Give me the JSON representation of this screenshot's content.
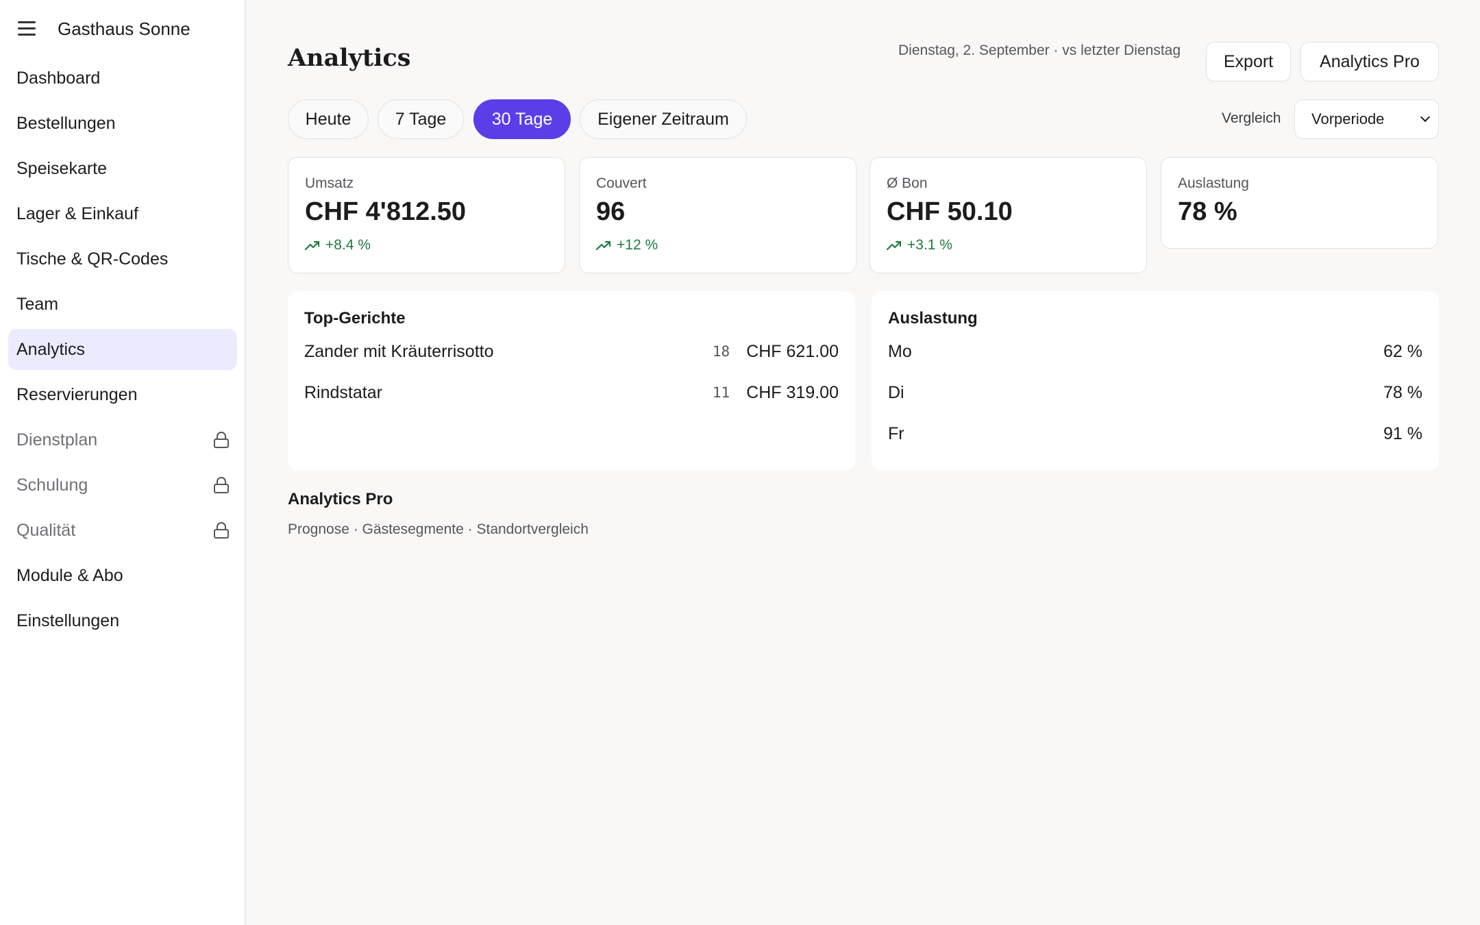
{
  "app": {
    "name": "Gasthaus Sonne"
  },
  "sidebar": {
    "items": [
      {
        "label": "Dashboard"
      },
      {
        "label": "Bestellungen"
      },
      {
        "label": "Speisekarte"
      },
      {
        "label": "Lager & Einkauf"
      },
      {
        "label": "Tische & QR-Codes"
      },
      {
        "label": "Team"
      },
      {
        "label": "Analytics",
        "active": true
      },
      {
        "label": "Reservierungen"
      },
      {
        "label": "Dienstplan",
        "locked": true
      },
      {
        "label": "Schulung",
        "locked": true
      },
      {
        "label": "Qualität",
        "locked": true
      },
      {
        "label": "Module & Abo"
      },
      {
        "label": "Einstellungen"
      }
    ]
  },
  "header": {
    "title": "Analytics",
    "date_info": "Dienstag, 2. September · vs letzter Dienstag",
    "export_label": "Export",
    "pro_label": "Analytics Pro"
  },
  "filters": {
    "ranges": [
      "Heute",
      "7 Tage",
      "30 Tage",
      "Eigener Zeitraum"
    ],
    "active_range": "30 Tage",
    "compare_label": "Vergleich",
    "compare_value": "Vorperiode"
  },
  "kpis": [
    {
      "label": "Umsatz",
      "value": "CHF 4'812.50",
      "delta": "+8.4 %"
    },
    {
      "label": "Couvert",
      "value": "96",
      "delta": "+12 %"
    },
    {
      "label": "Ø Bon",
      "value": "CHF 50.10",
      "delta": "+3.1 %"
    },
    {
      "label": "Auslastung",
      "value": "78 %"
    }
  ],
  "top_dishes": {
    "title": "Top-Gerichte",
    "rows": [
      {
        "name": "Zander mit Kräuterrisotto",
        "qty": "18",
        "amount": "CHF 621.00"
      },
      {
        "name": "Rindstatar",
        "qty": "11",
        "amount": "CHF 319.00"
      }
    ]
  },
  "occupancy": {
    "title": "Auslastung",
    "rows": [
      {
        "day": "Mo",
        "value": "62 %"
      },
      {
        "day": "Di",
        "value": "78 %"
      },
      {
        "day": "Fr",
        "value": "91 %"
      }
    ]
  },
  "pro_section": {
    "title": "Analytics Pro",
    "subtitle": "Prognose · Gästesegmente · Standortvergleich"
  },
  "colors": {
    "accent": "#5b3ee8",
    "active_nav_bg": "#ecebfd",
    "positive": "#1f7a3f",
    "background": "#f9f8f7"
  }
}
